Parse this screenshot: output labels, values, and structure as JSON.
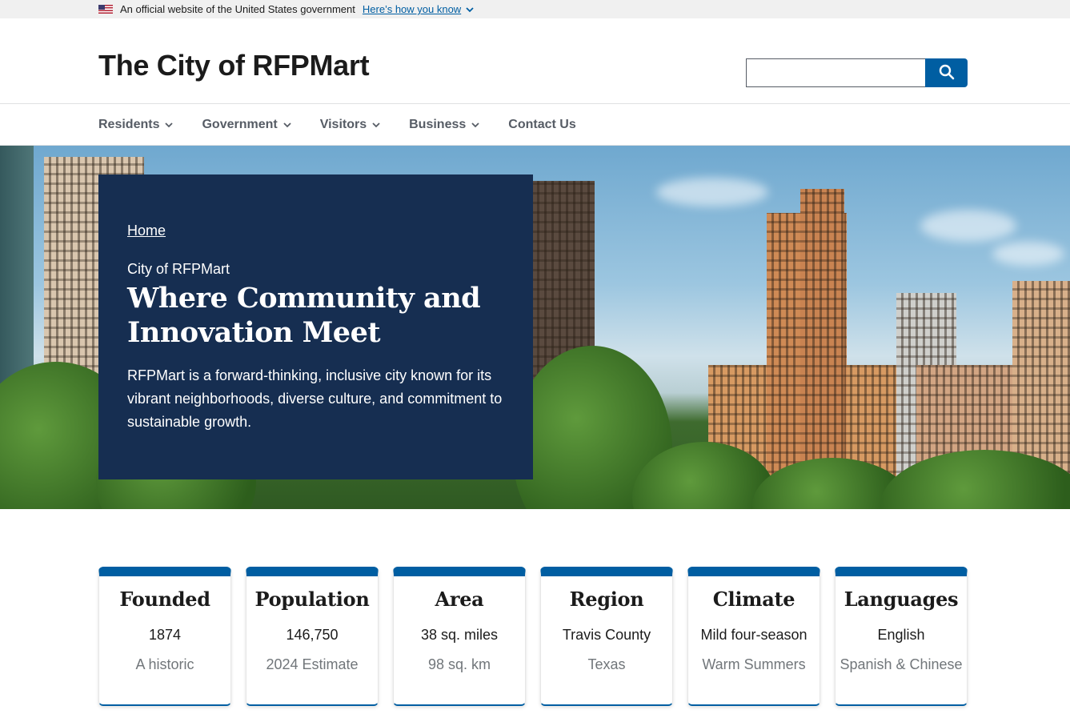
{
  "gov_banner": {
    "text": "An official website of the United States government",
    "link": "Here’s how you know"
  },
  "header": {
    "site_title": "The City of RFPMart",
    "search_placeholder": "",
    "search_icon": "search-icon"
  },
  "nav": {
    "items": [
      {
        "label": "Residents",
        "has_dropdown": true
      },
      {
        "label": "Government",
        "has_dropdown": true
      },
      {
        "label": "Visitors",
        "has_dropdown": true
      },
      {
        "label": "Business",
        "has_dropdown": true
      },
      {
        "label": "Contact Us",
        "has_dropdown": false
      }
    ]
  },
  "hero": {
    "breadcrumb": "Home",
    "eyebrow": "City of RFPMart",
    "title": "Where Community and Innovation Meet",
    "description": "RFPMart is a forward-thinking, inclusive city known for its vibrant neighborhoods, diverse culture, and commitment to sustainable growth."
  },
  "facts": [
    {
      "title": "Founded",
      "primary": "1874",
      "secondary": "A historic"
    },
    {
      "title": "Population",
      "primary": "146,750",
      "secondary": "2024 Estimate"
    },
    {
      "title": "Area",
      "primary": "38 sq. miles",
      "secondary": "98 sq. km"
    },
    {
      "title": "Region",
      "primary": "Travis County",
      "secondary": "Texas"
    },
    {
      "title": "Climate",
      "primary": "Mild four-season",
      "secondary": "Warm Summers"
    },
    {
      "title": "Languages",
      "primary": "English",
      "secondary": "Spanish & Chinese"
    }
  ],
  "colors": {
    "primary": "#005ea2",
    "hero_panel": "#162e51",
    "nav_text": "#565c65",
    "muted": "#71767a"
  }
}
